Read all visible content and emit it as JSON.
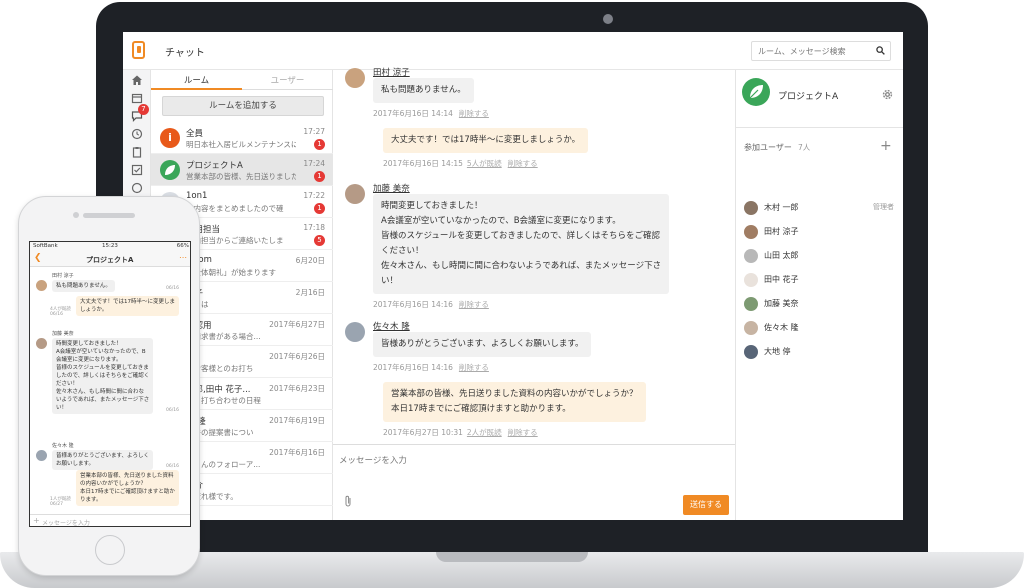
{
  "header": {
    "title": "チャット",
    "search_placeholder": "ルーム、メッセージ検索"
  },
  "rail": {
    "chat_badge": "7"
  },
  "rooms_panel": {
    "tabs": [
      "ルーム",
      "ユーザー"
    ],
    "add_room_label": "ルームを追加する",
    "rooms": [
      {
        "name": "全員",
        "preview": "明日本社入居ビルメンテナンスに",
        "time": "17:27",
        "badge": "1",
        "avatar_color": "#e8591a",
        "avatar_glyph": "i"
      },
      {
        "name": "プロジェクトA",
        "preview": "営業本部の皆様、先日送りました",
        "time": "17:24",
        "badge": "1",
        "avatar_color": "#3aa659",
        "avatar_glyph": "leaf"
      },
      {
        "name": "1on1",
        "preview": "の内容をまとめましたので確",
        "time": "17:22",
        "badge": "1"
      },
      {
        "name": "採用担当",
        "preview": "案内担当からご連絡いたしま",
        "time": "17:18",
        "badge": "5"
      },
      {
        "name": "o.com",
        "preview": "「全体朝礼」が始まります",
        "time": "6月20日",
        "badge": ""
      },
      {
        "name": "涼子",
        "preview": "にちは",
        "time": "2月16日",
        "badge": ""
      },
      {
        "name": "確認用",
        "preview": "の請求書がある場合...",
        "time": "2017年6月27日",
        "badge": ""
      },
      {
        "name": "部",
        "preview": "のお客様とのお打ち",
        "time": "2017年6月26日",
        "badge": ""
      },
      {
        "name": "一郎,田中 花子...",
        "preview": "より打ち合わせの日程",
        "time": "2017年6月23日",
        "badge": ""
      },
      {
        "name": "木 隆",
        "preview": "案件の提案書につい",
        "time": "2017年6月19日",
        "badge": ""
      },
      {
        "name": "停",
        "preview": "木くんのフォローア...",
        "time": "2017年6月16日",
        "badge": ""
      },
      {
        "name": "亮介",
        "preview": "お疲れ様です。",
        "time": "",
        "badge": ""
      },
      {
        "name": "",
        "preview": "",
        "time": "",
        "badge": ""
      }
    ]
  },
  "chat": {
    "messages": [
      {
        "sender": "田村 涼子",
        "lines": [
          "私も問題ありません。"
        ],
        "time": "2017年6月16日 14:14",
        "delete": "削除する",
        "mine": false
      },
      {
        "sender": "",
        "lines": [
          "大丈夫です！では17時半〜に変更しましょうか。"
        ],
        "time": "2017年6月16日 14:15",
        "read": "5人が既読",
        "delete": "削除する",
        "mine": true
      },
      {
        "sender": "加藤 美奈",
        "lines": [
          "時間変更しておきました！",
          "A会議室が空いていなかったので、B会議室に変更になります。",
          "皆様のスケジュールを変更しておきましたので、詳しくはそちらをご確認",
          "ください！",
          "佐々木さん、もし時間に間に合わないようであれば、またメッセージ下さ",
          "い！"
        ],
        "time": "2017年6月16日 14:16",
        "delete": "削除する",
        "mine": false
      },
      {
        "sender": "佐々木 隆",
        "lines": [
          "皆様ありがとうございます、よろしくお願いします。"
        ],
        "time": "2017年6月16日 14:16",
        "delete": "削除する",
        "mine": false
      },
      {
        "sender": "",
        "lines": [
          "営業本部の皆様、先日送りました資料の内容いかがでしょうか？",
          "本日17時までにご確認頂けますと助かります。"
        ],
        "time": "2017年6月27日 10:31",
        "read": "2人が既読",
        "delete": "削除する",
        "mine": true
      }
    ],
    "composer_placeholder": "メッセージを入力",
    "send_label": "送信する"
  },
  "room_info": {
    "title": "プロジェクトA",
    "members_heading": "参加ユーザー",
    "members_count": "7人",
    "members": [
      {
        "name": "木村 一郎",
        "role": "管理者"
      },
      {
        "name": "田村 涼子",
        "role": ""
      },
      {
        "name": "山田 太郎",
        "role": ""
      },
      {
        "name": "田中 花子",
        "role": ""
      },
      {
        "name": "加藤 美奈",
        "role": ""
      },
      {
        "name": "佐々木 隆",
        "role": ""
      },
      {
        "name": "大地 停",
        "role": ""
      }
    ]
  },
  "phone": {
    "status": {
      "carrier": "SoftBank",
      "clock": "15:23",
      "battery": "66%"
    },
    "title": "プロジェクトA",
    "messages": [
      {
        "sender": "田村 涼子",
        "lines": [
          "私も問題ありません。"
        ],
        "time": "06/16",
        "mine": false
      },
      {
        "sender": "",
        "lines": [
          "大丈夫です！では17時半〜に変更しま",
          "しょうか。"
        ],
        "time": "4人が既読 06/16",
        "mine": true
      },
      {
        "sender": "加藤 美奈",
        "lines": [
          "時間変更しておきました！",
          "A会議室が空いていなかったので、B",
          "会議室に変更になります。",
          "皆様のスケジュールを変更しておきま",
          "したので、詳しくはそちらをご確認く",
          "ださい！",
          "佐々木さん、もし時間に間に合わな",
          "いようであれば、またメッセージ下さ",
          "い！"
        ],
        "time": "06/16",
        "mine": false
      },
      {
        "sender": "佐々木 隆",
        "lines": [
          "皆様ありがとうございます、よろしく",
          "お願いします。"
        ],
        "time": "06/16",
        "mine": false
      },
      {
        "sender": "",
        "lines": [
          "営業本部の皆様、先日送りました資料",
          "の内容いかがでしょうか？",
          "本日17時までにご確認頂けますと助か",
          "ります。"
        ],
        "time": "1人が既読 06/27",
        "mine": true
      }
    ],
    "input_placeholder": "メッセージを入力"
  }
}
